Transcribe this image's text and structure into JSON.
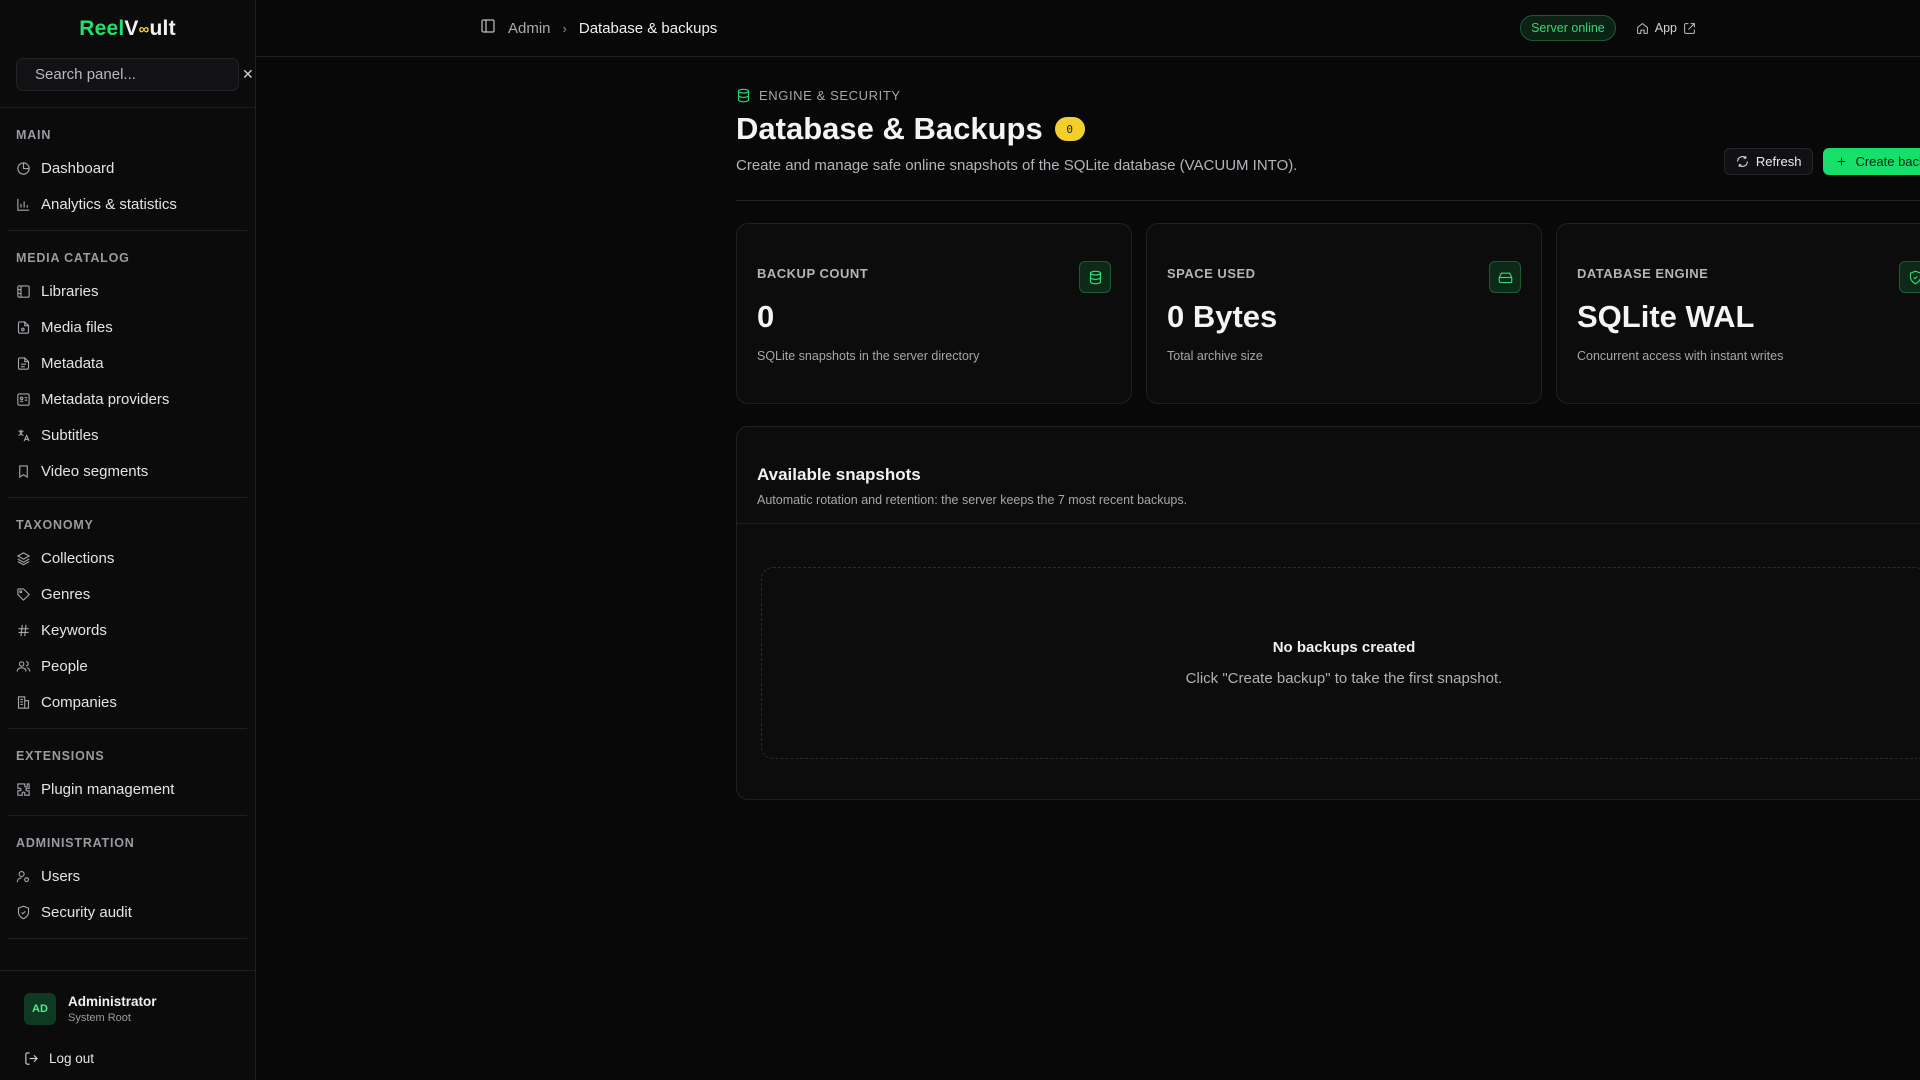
{
  "brand": {
    "part1": "Reel",
    "part2": "V",
    "mark": "∞",
    "part3": "ult"
  },
  "search": {
    "placeholder": "Search panel..."
  },
  "sidebar": {
    "sections": [
      {
        "heading": "MAIN",
        "items": [
          {
            "label": "Dashboard",
            "icon": "dashboard-icon"
          },
          {
            "label": "Analytics & statistics",
            "icon": "chart-icon"
          }
        ]
      },
      {
        "heading": "MEDIA CATALOG",
        "items": [
          {
            "label": "Libraries",
            "icon": "library-icon"
          },
          {
            "label": "Media files",
            "icon": "file-icon"
          },
          {
            "label": "Metadata",
            "icon": "document-icon"
          },
          {
            "label": "Metadata providers",
            "icon": "provider-icon"
          },
          {
            "label": "Subtitles",
            "icon": "translate-icon"
          },
          {
            "label": "Video segments",
            "icon": "bookmark-icon"
          }
        ]
      },
      {
        "heading": "TAXONOMY",
        "items": [
          {
            "label": "Collections",
            "icon": "layers-icon"
          },
          {
            "label": "Genres",
            "icon": "tag-icon"
          },
          {
            "label": "Keywords",
            "icon": "hash-icon"
          },
          {
            "label": "People",
            "icon": "people-icon"
          },
          {
            "label": "Companies",
            "icon": "building-icon"
          }
        ]
      },
      {
        "heading": "EXTENSIONS",
        "items": [
          {
            "label": "Plugin management",
            "icon": "puzzle-icon"
          }
        ]
      },
      {
        "heading": "ADMINISTRATION",
        "items": [
          {
            "label": "Users",
            "icon": "user-icon"
          },
          {
            "label": "Security audit",
            "icon": "shield-icon"
          }
        ]
      }
    ]
  },
  "user": {
    "initials": "AD",
    "name": "Administrator",
    "role": "System Root"
  },
  "logout_label": "Log out",
  "breadcrumb": {
    "parent": "Admin",
    "current": "Database & backups"
  },
  "status": {
    "online": "Server online",
    "app_link": "App"
  },
  "page": {
    "eyebrow": "ENGINE & SECURITY",
    "title": "Database & Backups",
    "count_badge": "0",
    "subtitle": "Create and manage safe online snapshots of the SQLite database (VACUUM INTO).",
    "refresh_label": "Refresh",
    "create_label": "Create backup"
  },
  "stats": [
    {
      "label": "BACKUP COUNT",
      "value": "0",
      "desc": "SQLite snapshots in the server directory",
      "icon": "database-icon"
    },
    {
      "label": "SPACE USED",
      "value": "0 Bytes",
      "desc": "Total archive size",
      "icon": "hard-drive-icon"
    },
    {
      "label": "DATABASE ENGINE",
      "value": "SQLite WAL",
      "desc": "Concurrent access with instant writes",
      "icon": "shield-check-icon"
    }
  ],
  "snapshots": {
    "title": "Available snapshots",
    "subtitle": "Automatic rotation and retention: the server keeps the 7 most recent backups.",
    "empty_title": "No backups created",
    "empty_desc": "Click \"Create backup\" to take the first snapshot."
  },
  "colors": {
    "accent": "#16e06a",
    "badge": "#f2cf2b",
    "background": "#080809"
  }
}
